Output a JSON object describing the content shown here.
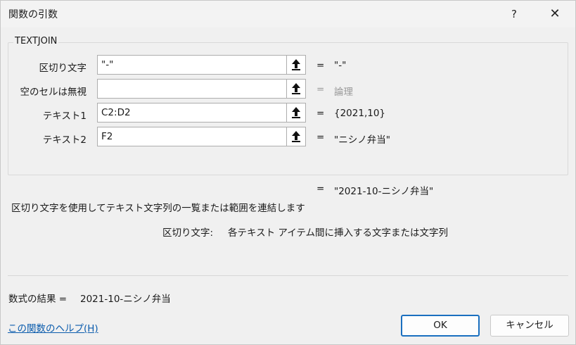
{
  "window": {
    "title": "関数の引数",
    "help_label": "?",
    "close_label": "✕"
  },
  "function_name": "TEXTJOIN",
  "arguments": [
    {
      "label": "区切り文字",
      "input": "\"-\"",
      "equals": "=",
      "value": "\"-\"",
      "muted": false
    },
    {
      "label": "空のセルは無視",
      "input": "",
      "equals": "=",
      "value": "論理",
      "muted": true
    },
    {
      "label": "テキスト1",
      "input": "C2:D2",
      "equals": "=",
      "value": "{2021,10}",
      "muted": false
    },
    {
      "label": "テキスト2",
      "input": "F2",
      "equals": "=",
      "value": "\"ニシノ弁当\"",
      "muted": false
    }
  ],
  "result": {
    "equals": "=",
    "value": "\"2021-10-ニシノ弁当\""
  },
  "function_description": "区切り文字を使用してテキスト文字列の一覧または範囲を連結します",
  "argument_help": {
    "name": "区切り文字:",
    "text": "各テキスト アイテム間に挿入する文字または文字列"
  },
  "formula_result": {
    "label": "数式の結果 =",
    "value": "2021-10-ニシノ弁当"
  },
  "help_link": "この関数のヘルプ(H)",
  "buttons": {
    "ok": "OK",
    "cancel": "キャンセル"
  },
  "icons": {
    "ref_button": "collapse-dialog-icon",
    "close": "close-icon"
  }
}
